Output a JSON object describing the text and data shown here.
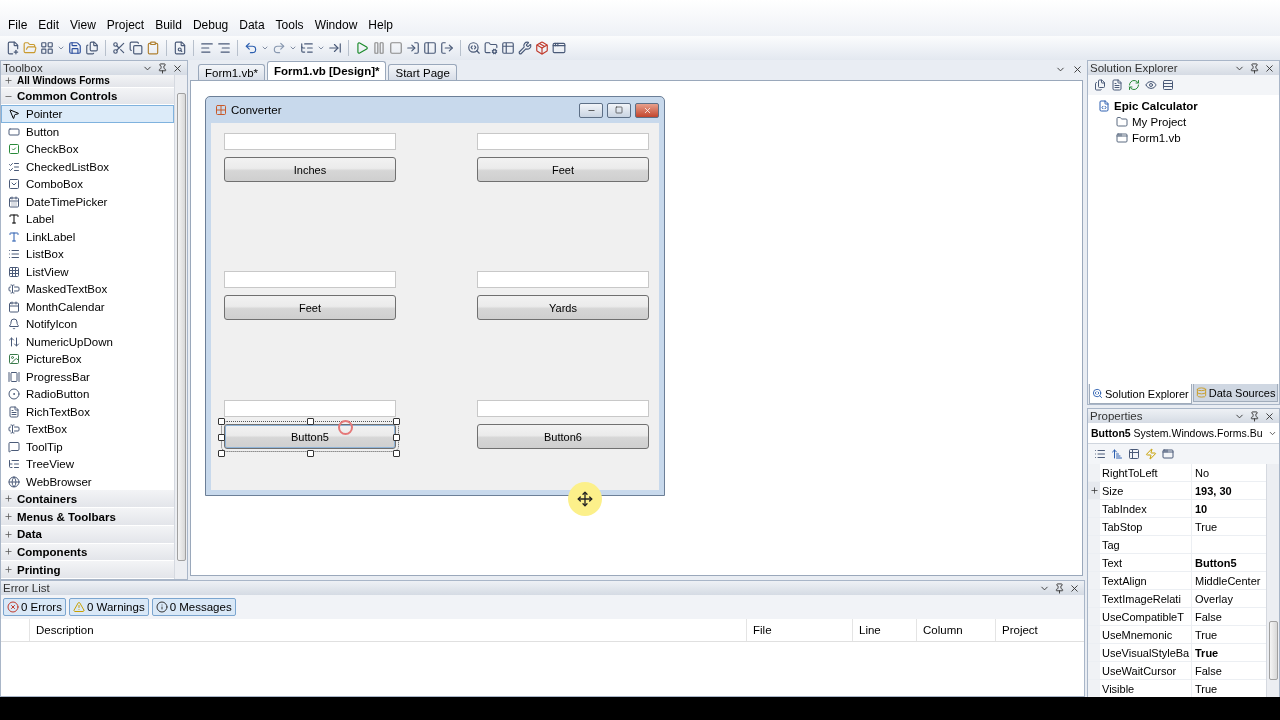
{
  "menu": [
    "File",
    "Edit",
    "View",
    "Project",
    "Build",
    "Debug",
    "Data",
    "Tools",
    "Window",
    "Help"
  ],
  "toolbox": {
    "title": "Toolbox",
    "groups": [
      {
        "label": "All Windows Forms",
        "expanded": false
      },
      {
        "label": "Common Controls",
        "expanded": true,
        "items": [
          {
            "label": "Pointer",
            "selected": true
          },
          {
            "label": "Button",
            "selected": false
          },
          {
            "label": "CheckBox",
            "selected": false
          },
          {
            "label": "CheckedListBox",
            "selected": false
          },
          {
            "label": "ComboBox",
            "selected": false
          },
          {
            "label": "DateTimePicker",
            "selected": false
          },
          {
            "label": "Label",
            "selected": false
          },
          {
            "label": "LinkLabel",
            "selected": false
          },
          {
            "label": "ListBox",
            "selected": false
          },
          {
            "label": "ListView",
            "selected": false
          },
          {
            "label": "MaskedTextBox",
            "selected": false
          },
          {
            "label": "MonthCalendar",
            "selected": false
          },
          {
            "label": "NotifyIcon",
            "selected": false
          },
          {
            "label": "NumericUpDown",
            "selected": false
          },
          {
            "label": "PictureBox",
            "selected": false
          },
          {
            "label": "ProgressBar",
            "selected": false
          },
          {
            "label": "RadioButton",
            "selected": false
          },
          {
            "label": "RichTextBox",
            "selected": false
          },
          {
            "label": "TextBox",
            "selected": false
          },
          {
            "label": "ToolTip",
            "selected": false
          },
          {
            "label": "TreeView",
            "selected": false
          },
          {
            "label": "WebBrowser",
            "selected": false
          }
        ]
      },
      {
        "label": "Containers",
        "expanded": false
      },
      {
        "label": "Menus & Toolbars",
        "expanded": false
      },
      {
        "label": "Data",
        "expanded": false
      },
      {
        "label": "Components",
        "expanded": false
      },
      {
        "label": "Printing",
        "expanded": false
      }
    ]
  },
  "editor_tabs": [
    {
      "label": "Form1.vb*",
      "selected": false
    },
    {
      "label": "Form1.vb [Design]*",
      "selected": true
    },
    {
      "label": "Start Page",
      "selected": false
    }
  ],
  "form": {
    "title": "Converter",
    "rows": [
      {
        "controls": [
          {
            "button": "Inches",
            "selected": false
          },
          {
            "button": "Feet",
            "selected": false
          }
        ]
      },
      {
        "controls": [
          {
            "button": "Feet",
            "selected": false
          },
          {
            "button": "Yards",
            "selected": false
          }
        ]
      },
      {
        "controls": [
          {
            "button": "Button5",
            "selected": true
          },
          {
            "button": "Button6",
            "selected": false
          }
        ]
      }
    ]
  },
  "solution_explorer": {
    "title": "Solution Explorer",
    "tree": [
      {
        "label": "Epic Calculator",
        "children": [
          {
            "label": "My Project"
          },
          {
            "label": "Form1.vb"
          }
        ]
      }
    ],
    "tabs": [
      {
        "label": "Solution Explorer",
        "selected": true
      },
      {
        "label": "Data Sources",
        "selected": false
      }
    ]
  },
  "properties": {
    "title": "Properties",
    "object": "**Button5** System.Windows.Forms.Bu",
    "rows": [
      {
        "name": "RightToLeft",
        "value": "No",
        "bold": false,
        "expandable": false
      },
      {
        "name": "Size",
        "value": "193, 30",
        "bold": true,
        "expandable": true
      },
      {
        "name": "TabIndex",
        "value": "10",
        "bold": true,
        "expandable": false
      },
      {
        "name": "TabStop",
        "value": "True",
        "bold": false,
        "expandable": false
      },
      {
        "name": "Tag",
        "expandable": false
      },
      {
        "name": "Text",
        "value": "Button5",
        "bold": true,
        "expandable": false
      },
      {
        "name": "TextAlign",
        "value": "MiddleCenter",
        "bold": false,
        "expandable": false
      },
      {
        "name": "TextImageRelati",
        "value": "Overlay",
        "bold": false,
        "expandable": false
      },
      {
        "name": "UseCompatibleT",
        "value": "False",
        "bold": false,
        "expandable": false
      },
      {
        "name": "UseMnemonic",
        "value": "True",
        "bold": false,
        "expandable": false
      },
      {
        "name": "UseVisualStyleBa",
        "value": "True",
        "bold": true,
        "expandable": false
      },
      {
        "name": "UseWaitCursor",
        "value": "False",
        "bold": false,
        "expandable": false
      },
      {
        "name": "Visible",
        "value": "True",
        "bold": false,
        "expandable": false
      }
    ]
  },
  "error_list": {
    "title": "Error List",
    "filters": [
      {
        "kind": "error",
        "label": "0 Errors",
        "selected": true
      },
      {
        "kind": "warning",
        "label": "0 Warnings",
        "selected": true
      },
      {
        "kind": "info",
        "label": "0 Messages",
        "selected": true
      }
    ],
    "columns": [
      "Description",
      "File",
      "Line",
      "Column",
      "Project"
    ]
  }
}
